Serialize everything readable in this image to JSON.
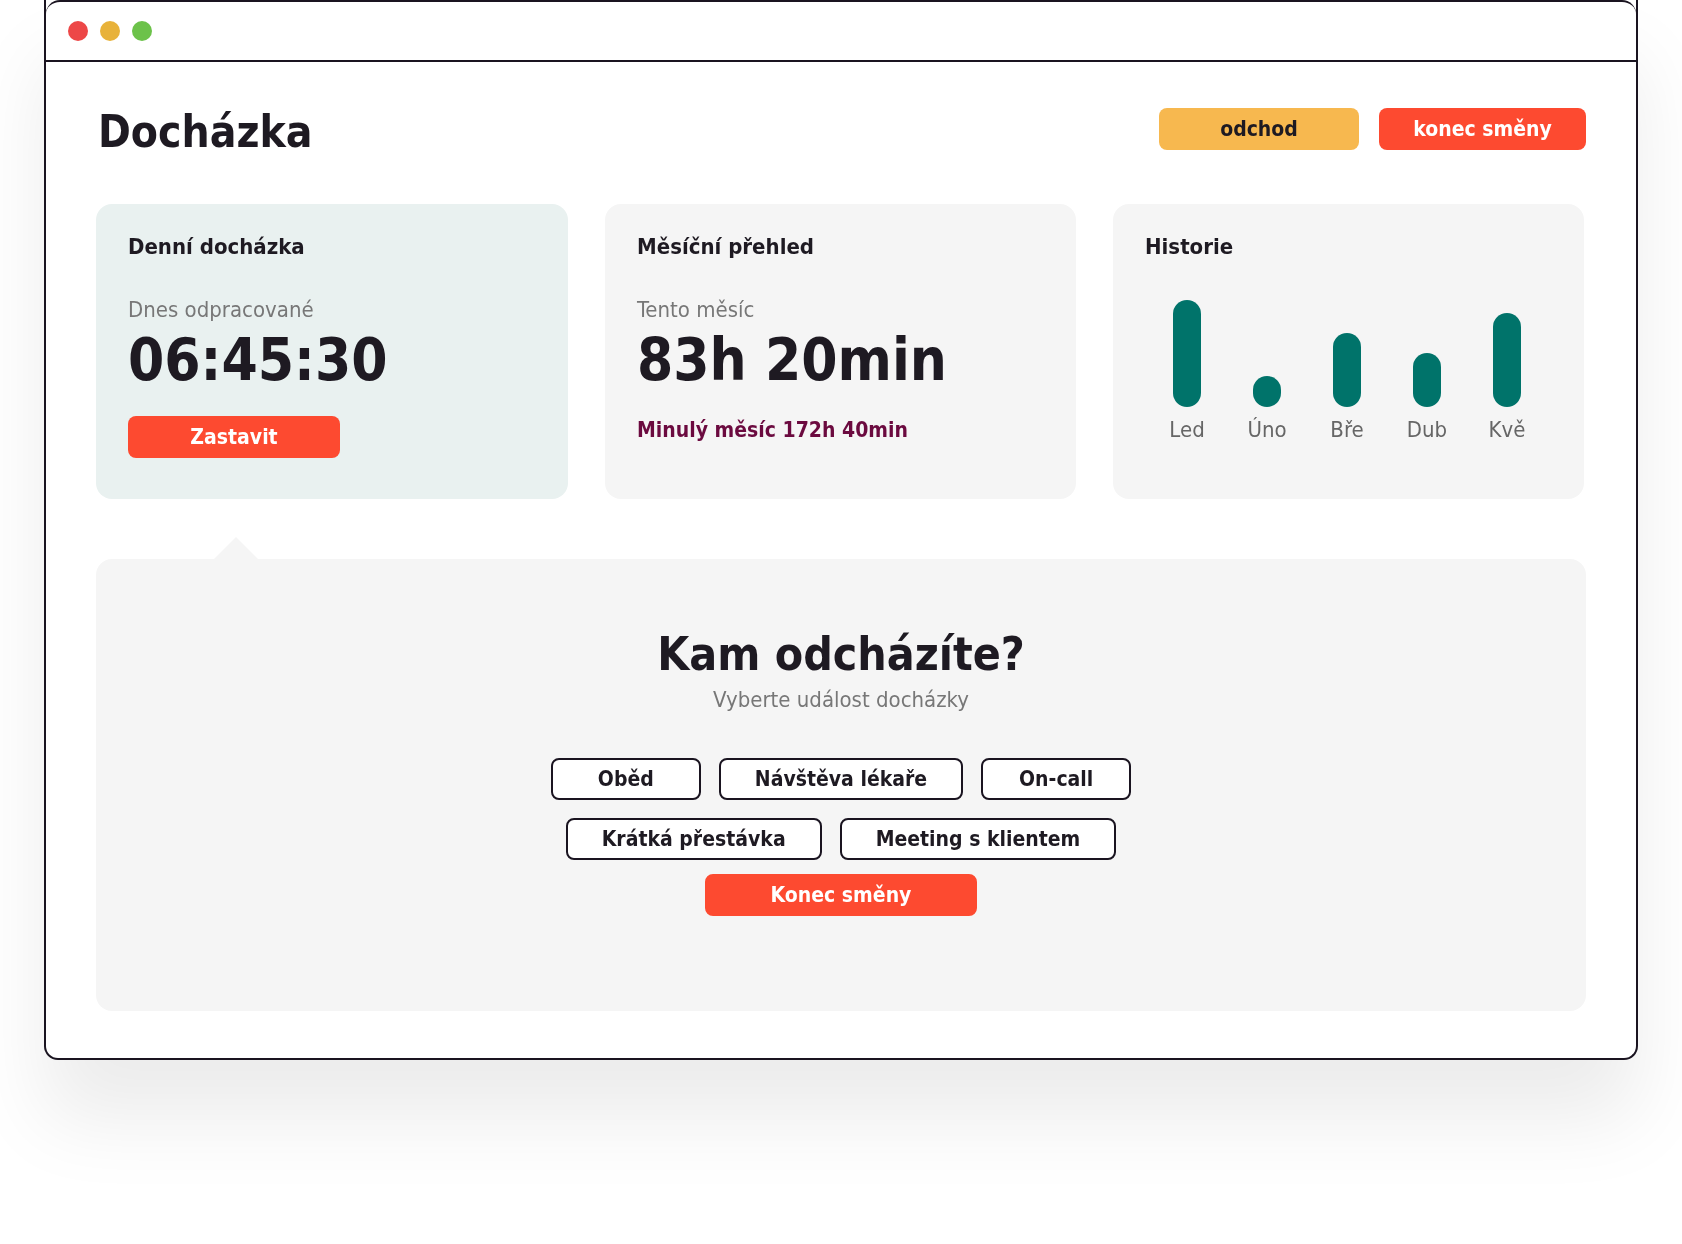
{
  "window": {
    "controls": [
      {
        "color": "#ed4747"
      },
      {
        "color": "#e8b23a"
      },
      {
        "color": "#6cc24a"
      }
    ]
  },
  "header": {
    "title": "Docházka",
    "buttons": [
      {
        "label": "odchod",
        "kind": "warning"
      },
      {
        "label": "konec směny",
        "kind": "danger"
      }
    ]
  },
  "daily": {
    "title": "Denní docházka",
    "label": "Dnes odpracované",
    "time": "06:45:30",
    "button": "Zastavit"
  },
  "monthly": {
    "title": "Měsíční přehled",
    "label": "Tento měsíc",
    "total": "83h 20min",
    "previous": "Minulý měsíc 172h 40min"
  },
  "history": {
    "title": "Historie",
    "months": [
      "Led",
      "Úno",
      "Bře",
      "Dub",
      "Kvě"
    ]
  },
  "dialog": {
    "title": "Kam odcházíte?",
    "subtitle": "Vyberte událost docházky",
    "rows": [
      [
        {
          "label": "Oběd",
          "kind": "option"
        },
        {
          "label": "Návštěva lékaře",
          "kind": "option"
        },
        {
          "label": "On-call",
          "kind": "option"
        }
      ],
      [
        {
          "label": "Krátká přestávka",
          "kind": "option"
        },
        {
          "label": "Meeting s klientem",
          "kind": "option"
        }
      ],
      [
        {
          "label": "Konec směny",
          "kind": "primary"
        }
      ]
    ]
  }
}
